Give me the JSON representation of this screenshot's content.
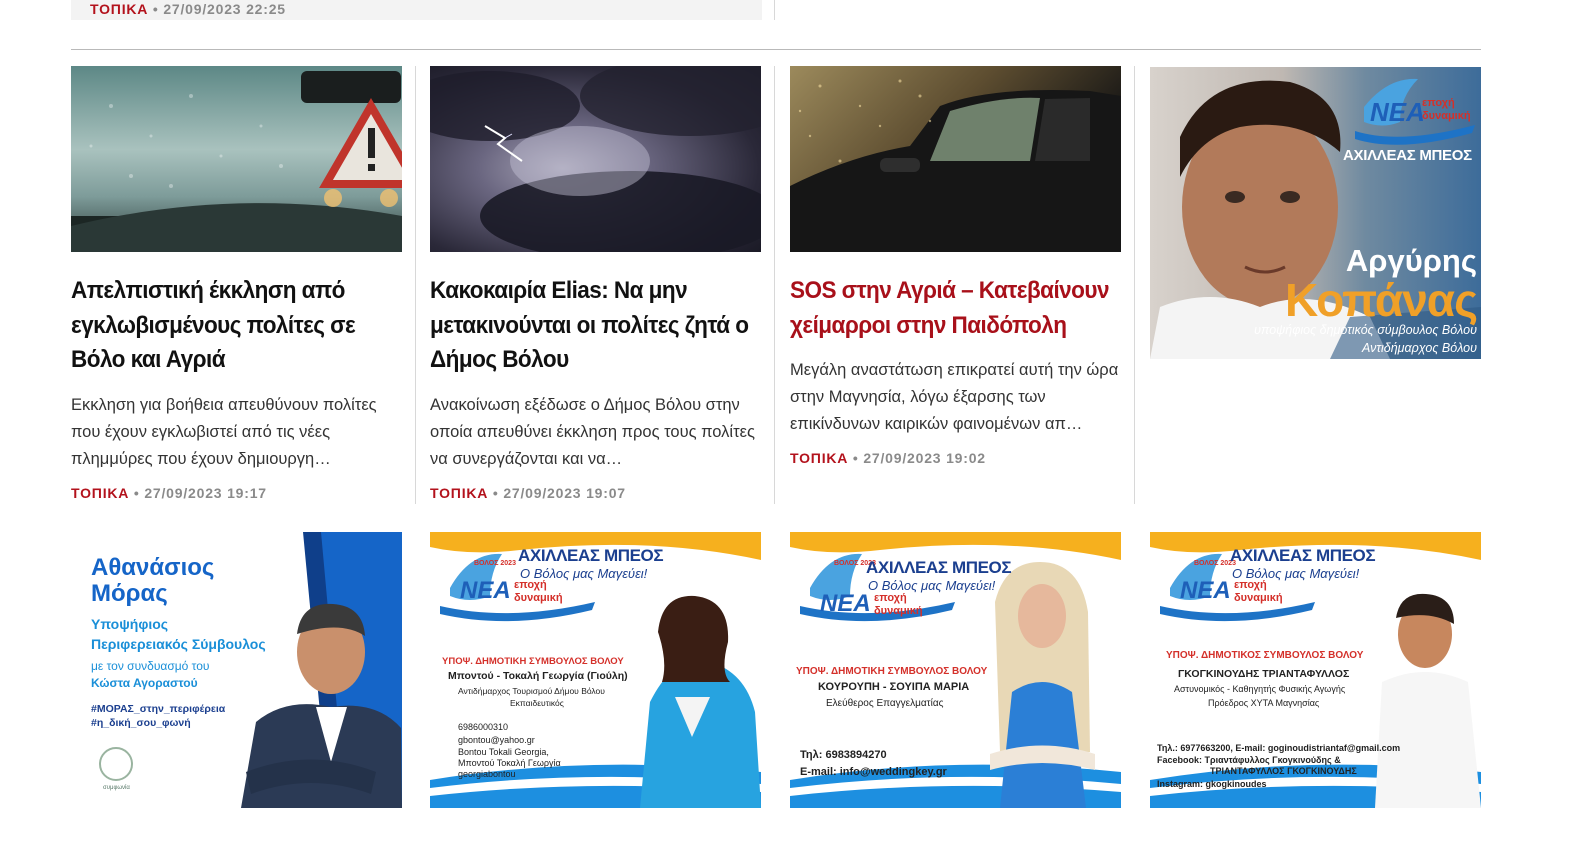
{
  "previous_item": {
    "category": "ΤΟΠΙΚΑ",
    "date": "• 27/09/2023 22:25"
  },
  "articles": [
    {
      "title": "Απελπιστική έκκληση από εγκλωβισμένους πολίτες σε Βόλο και Αγριά",
      "excerpt": "Εκκληση για βοήθεια απευθύνουν πολίτες που έχουν εγκλωβιστεί από τις νέες πλημμύρες που έχουν δημιουργη…",
      "category": "ΤΟΠΙΚΑ",
      "date": "• 27/09/2023 19:17",
      "image": "warning-sign-rain-windshield"
    },
    {
      "title": "Κακοκαιρία Elias: Να μην μετακινούνται οι πολίτες ζητά ο Δήμος Βόλου",
      "excerpt": "Ανακοίνωση εξέδωσε ο Δήμος Βόλου στην οποία απευθύνει έκκληση προς τους πολίτες να συνεργάζονται και να…",
      "category": "ΤΟΠΙΚΑ",
      "date": "• 27/09/2023 19:07",
      "image": "storm-clouds-lightning"
    },
    {
      "title": "SOS στην Αγριά – Κατεβαίνουν χείμαρροι στην Παιδόπολη",
      "excerpt": "Μεγάλη αναστάτωση επικρατεί αυτή την ώρα στην Μαγνησία, λόγω έξαρσης των επικίνδυνων καιρικών φαινομένων απ…",
      "category": "ΤΟΠΙΚΑ",
      "date": "• 27/09/2023 19:02",
      "image": "car-in-heavy-rain",
      "accent": "#a8101a"
    }
  ],
  "banner_top": {
    "logo_word": "ΝΕΑ",
    "logo_sub1": "εποχή",
    "logo_sub2": "δυναμική",
    "leader": "ΑΧΙΛΛΕΑΣ ΜΠΕΟΣ",
    "first_name": "Αργύρης",
    "last_name": "Κοπάνας",
    "role": "υποψήφιος δημοτικός σύμβουλος Βόλου",
    "role2": "Αντιδήμαρχος Βόλου"
  },
  "bottom_ads": [
    {
      "name_line1": "Αθανάσιος",
      "name_line2": "Μόρας",
      "role_line1": "Υποψήφιος",
      "role_line2": "Περιφερειακός Σύμβουλος",
      "with_line1": "με τον συνδυασμό του",
      "with_line2": "Κώστα Αγοραστού",
      "hashtag1": "#ΜΟΡΑΣ_στην_περιφέρεια",
      "hashtag2": "#η_δική_σου_φωνή",
      "brand": "συμφωνία"
    },
    {
      "year": "ΒΟΛΟΣ 2023",
      "leader": "ΑΧΙΛΛΕΑΣ ΜΠΕΟΣ",
      "slogan": "Ο Βόλος μας Μαγεύει!",
      "logo_word": "ΝΕΑ",
      "logo_sub1": "εποχή",
      "logo_sub2": "δυναμική",
      "office": "ΥΠΟΨ. ΔΗΜΟΤΙΚΗ ΣΥΜΒΟΥΛΟΣ ΒΟΛΟΥ",
      "name": "Μποντού - Τοκαλή Γεωργία (Γιούλη)",
      "desc1": "Αντιδήμαρχος Τουρισμού Δήμου Βόλου",
      "desc2": "Εκπαιδευτικός",
      "contact1": "6986000310",
      "contact2": "gbontou@yahoo.gr",
      "contact3": "Bontou Tokali Georgia,",
      "contact4": "Μποντού Τοκαλή Γεωργία",
      "contact5": "georgiabontou"
    },
    {
      "year": "ΒΟΛΟΣ 2023",
      "leader": "ΑΧΙΛΛΕΑΣ ΜΠΕΟΣ",
      "slogan": "Ο Βόλος μας Μαγεύει!",
      "logo_word": "ΝΕΑ",
      "logo_sub1": "εποχή",
      "logo_sub2": "δυναμική",
      "office": "ΥΠΟΨ. ΔΗΜΟΤΙΚΗ ΣΥΜΒΟΥΛΟΣ ΒΟΛΟΥ",
      "name": "ΚΟΥΡΟΥΠΗ - ΣΟΥΙΠΑ ΜΑΡΙΑ",
      "desc1": "Ελεύθερος Επαγγελματίας",
      "contact1": "Τηλ: 6983894270",
      "contact2": "E-mail: info@weddingkey.gr"
    },
    {
      "year": "ΒΟΛΟΣ 2023",
      "leader": "ΑΧΙΛΛΕΑΣ ΜΠΕΟΣ",
      "slogan": "Ο Βόλος μας Μαγεύει!",
      "logo_word": "ΝΕΑ",
      "logo_sub1": "εποχή",
      "logo_sub2": "δυναμική",
      "office": "ΥΠΟΨ. ΔΗΜΟΤΙΚΟΣ ΣΥΜΒΟΥΛΟΣ ΒΟΛΟΥ",
      "name": "ΓΚΟΓΚΙΝΟΥΔΗΣ ΤΡΙΑΝΤΑΦΥΛΛΟΣ",
      "desc1": "Αστυνομικός - Καθηγητής Φυσικής Αγωγής",
      "desc2": "Πρόεδρος ΧΥΤΑ Μαγνησίας",
      "contact1": "Τηλ.: 6977663200, E-mail:  goginoudistriantaf@gmail.com",
      "contact2": "Facebook: Τριαντάφυλλος  Γκογκινούδης &",
      "contact3": "ΤΡΙΑΝΤΑΦΥΛΛΟΣ ΓΚΟΓΚΙΝΟΥΔΗΣ",
      "contact4": "Instagram: gkogkinoudes"
    }
  ]
}
